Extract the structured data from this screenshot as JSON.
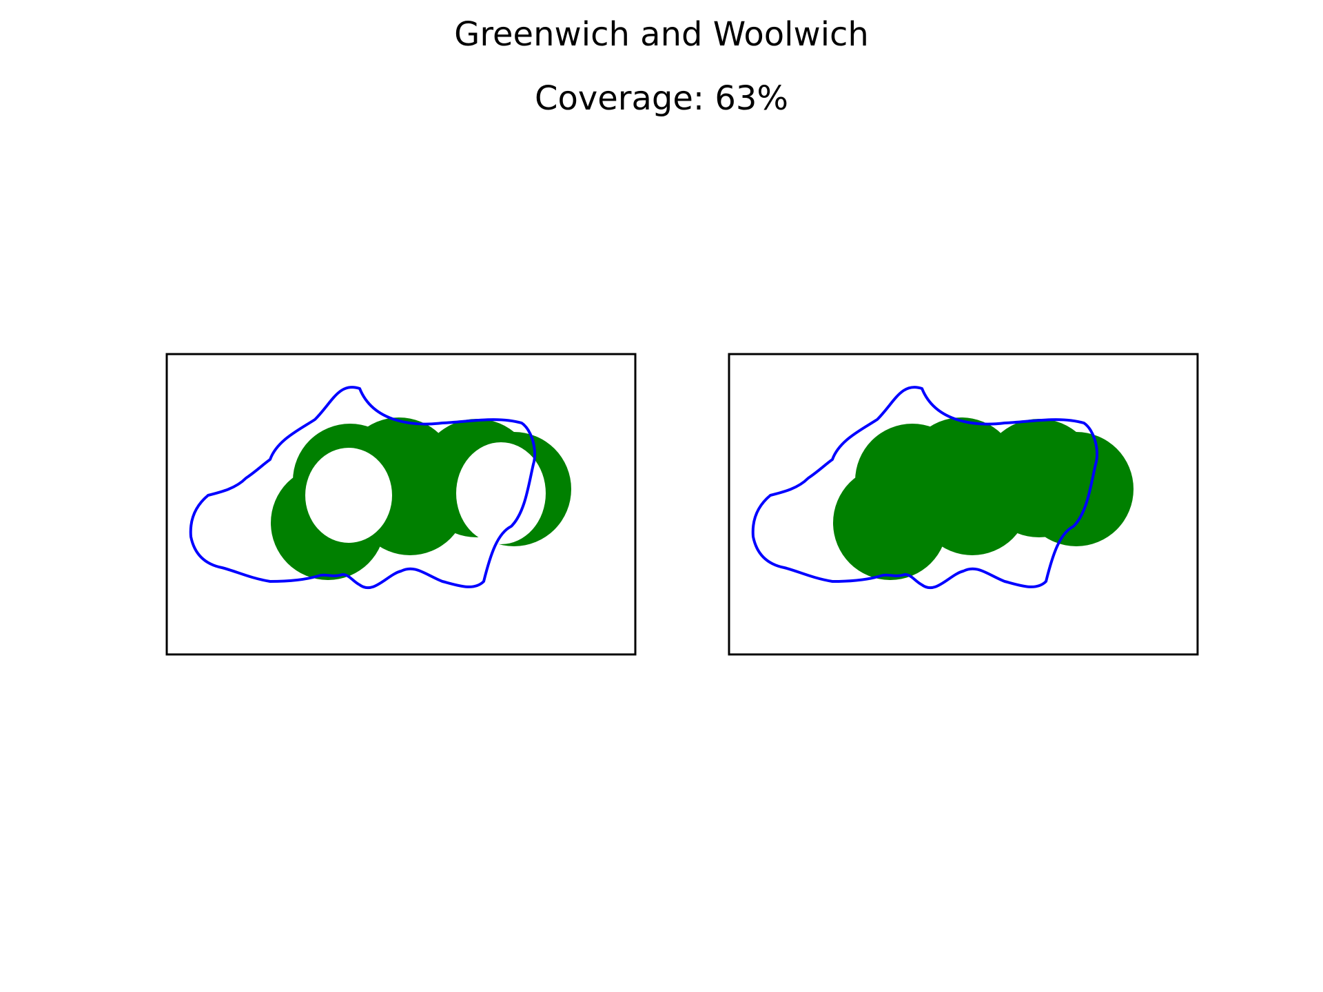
{
  "title": "Greenwich and Woolwich",
  "coverage_label": "Coverage: 63%",
  "coverage_fraction": 0.63,
  "colors": {
    "boundary": "#0000ff",
    "coverage": "#008000",
    "frame": "#000000",
    "background": "#ffffff"
  },
  "panels": [
    {
      "name": "panel-left",
      "style": "rings"
    },
    {
      "name": "panel-right",
      "style": "filled"
    }
  ]
}
